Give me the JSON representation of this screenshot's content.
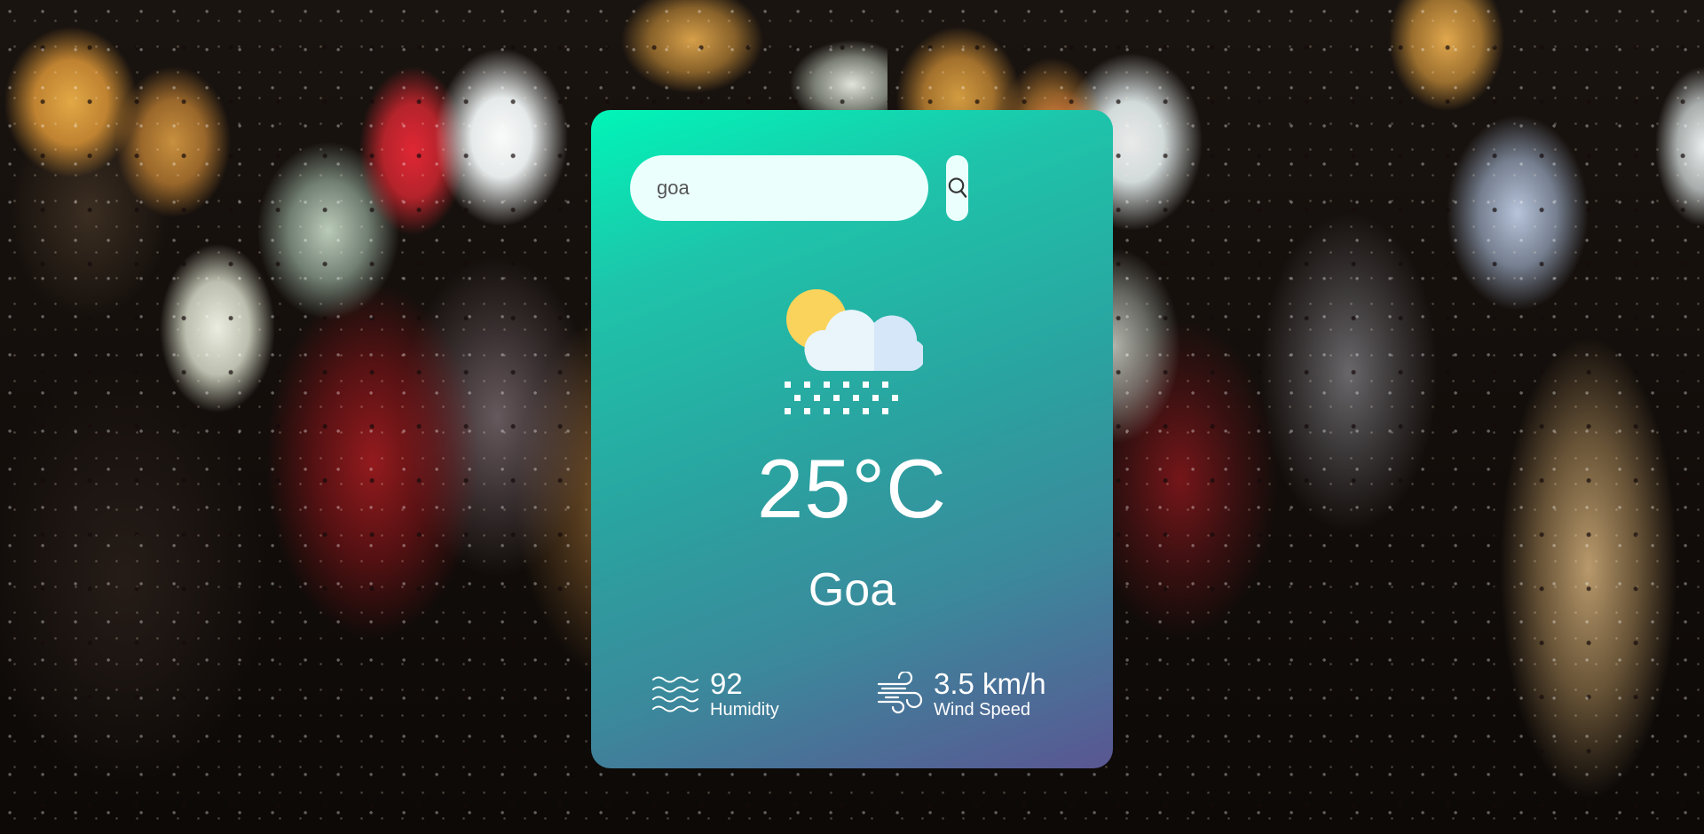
{
  "search": {
    "value": "goa",
    "button_icon": "search-icon"
  },
  "weather": {
    "icon": "sun-cloud-snow-icon",
    "temperature": "25°C",
    "city": "Goa"
  },
  "details": {
    "humidity": {
      "icon": "humidity-waves-icon",
      "value": "92",
      "label": "Humidity"
    },
    "wind": {
      "icon": "wind-icon",
      "value": "3.5 km/h",
      "label": "Wind Speed"
    }
  },
  "colors": {
    "card_gradient_start": "#00f5b8",
    "card_gradient_end": "#5a5692",
    "text": "#ffffff",
    "input_bg": "#ebfffc"
  }
}
